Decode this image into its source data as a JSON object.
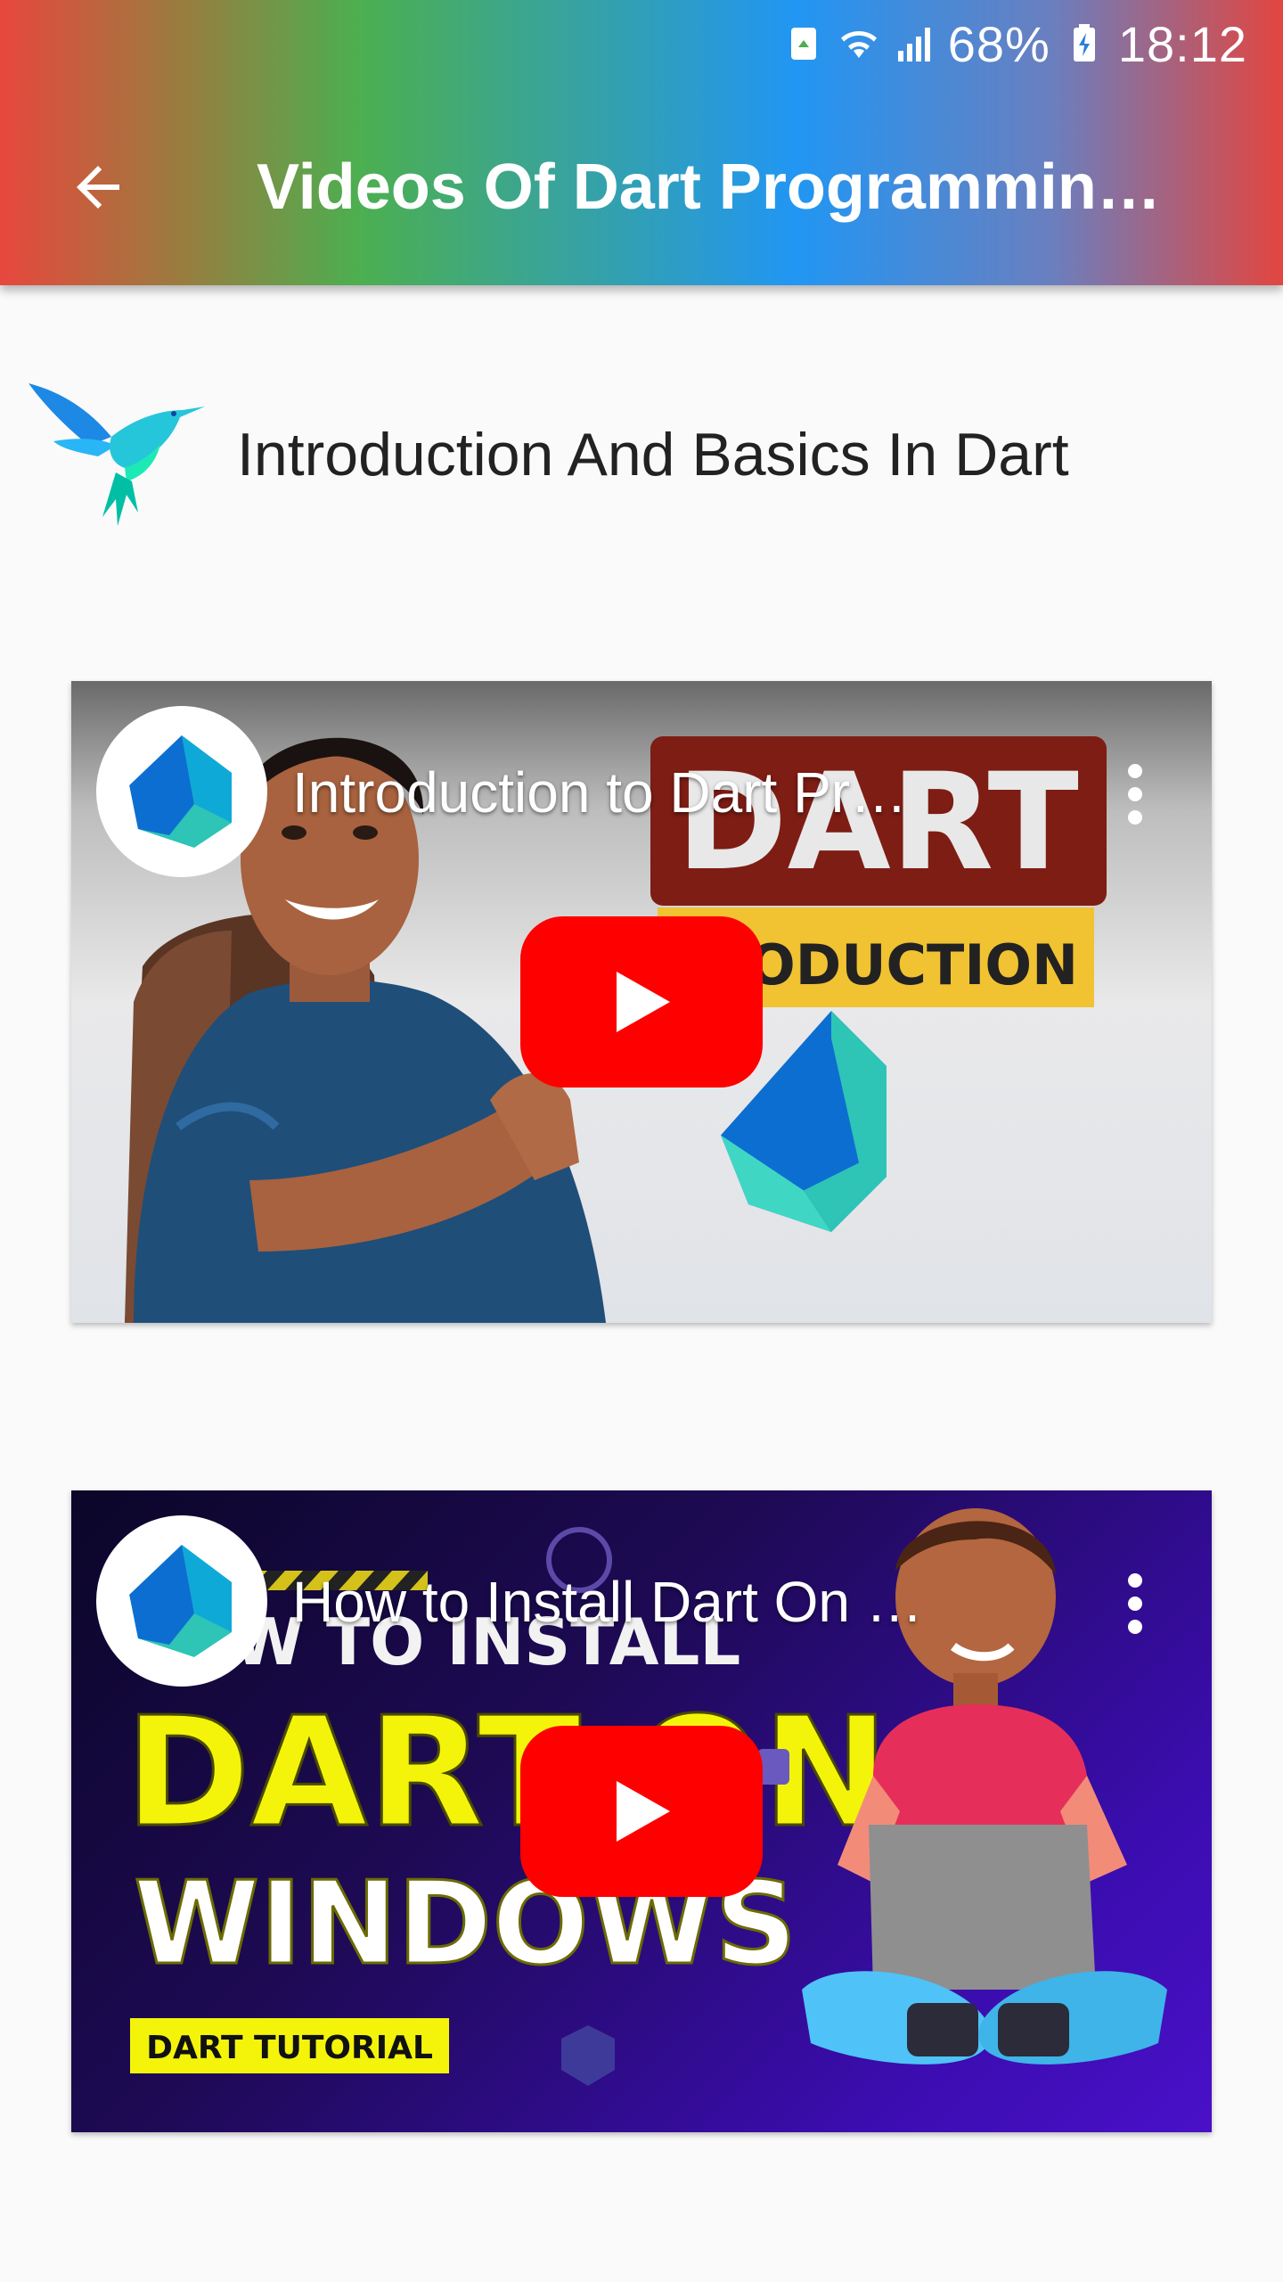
{
  "status_bar": {
    "battery_percent": "68%",
    "time": "18:12"
  },
  "app_bar": {
    "title": "Videos Of Dart Programmin…",
    "gradient_colors": [
      "#e8473d",
      "#4caf50",
      "#2196f3",
      "#e2463f"
    ]
  },
  "section": {
    "title": "Introduction And Basics In Dart"
  },
  "videos": [
    {
      "title": "Introduction to Dart Pr…",
      "thumb_text_1": "DART",
      "thumb_text_2": "RODUCTION"
    },
    {
      "title": "How to Install Dart On …",
      "thumb_text_1": "HOW TO INSTALL",
      "thumb_text_2": "DART ON",
      "thumb_text_3": "WINDOWS",
      "thumb_text_4": "DART TUTORIAL"
    }
  ],
  "colors": {
    "play_button": "#ff0000",
    "dart_teal": "#2ec4b6",
    "dart_blue": "#0d6ed1"
  }
}
